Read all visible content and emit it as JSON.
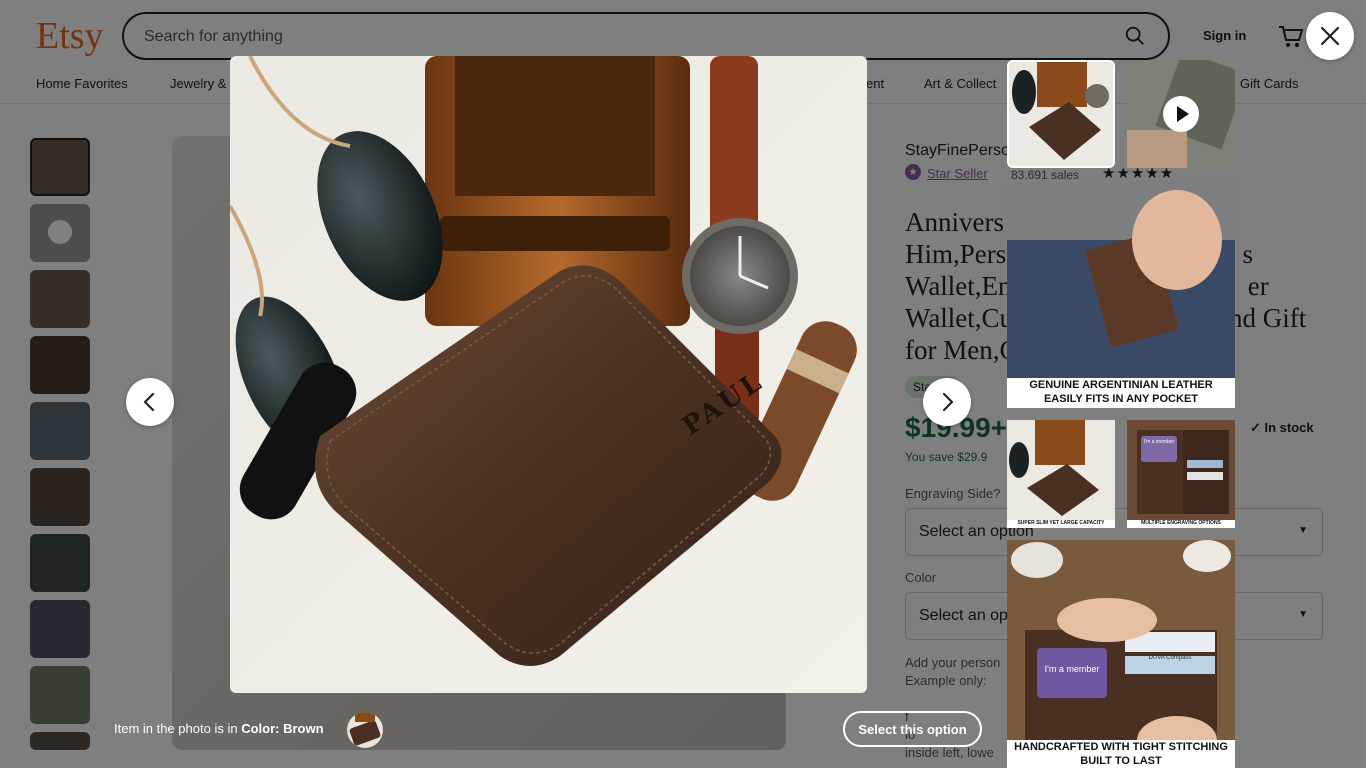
{
  "header": {
    "logo": "Etsy",
    "search_placeholder": "Search for anything",
    "sign_in": "Sign in",
    "categories": [
      "Home Favorites",
      "Jewelry &",
      "ent",
      "Art & Collect",
      "Gift Cards"
    ]
  },
  "listing": {
    "shop_name": "StayFinePerso",
    "star_seller": "Star Seller",
    "sales": "83,691 sales",
    "stars": "★★★★★",
    "title_lines": [
      "Annivers",
      "Him,Pers                                   s",
      "Wallet,En                                   er",
      "Wallet,Cu                                nd Gift",
      "for Men,G"
    ],
    "badge": "Sta      l",
    "price": "$19.99+",
    "in_stock": "In stock",
    "you_save": "You save $29.9",
    "engraving_label": "Engraving Side?",
    "engraving_value": "Select an option",
    "color_label": "Color",
    "color_value": "Select an op",
    "personalization_1": "Add your person",
    "personalization_2": "Example only:",
    "fragments": [
      "f",
      "lo",
      "inside left, lowe"
    ]
  },
  "lightbox": {
    "caption_prefix": "Item in the photo is in ",
    "caption_color": "Color: Brown",
    "select_option": "Select this option",
    "engraved_name": "PAUL",
    "gallery_captions": {
      "leather": [
        "GENUINE ARGENTINIAN LEATHER",
        "EASILY FITS IN ANY POCKET"
      ],
      "slim": "SUPER SLIM YET LARGE CAPACITY",
      "engraving": "MULTIPLE ENGRAVING OPTIONS",
      "stitching": [
        "HANDCRAFTED WITH TIGHT STITCHING",
        "BUILT TO LAST"
      ]
    },
    "card_texts": {
      "member": "I'm a member",
      "brand": "DUVA Compass"
    }
  }
}
